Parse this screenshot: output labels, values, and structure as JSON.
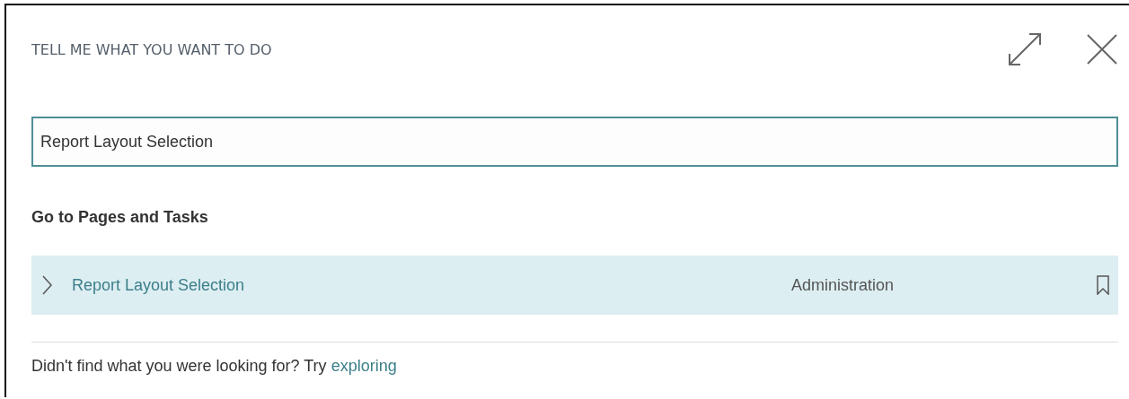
{
  "dialog": {
    "title": "TELL ME WHAT YOU WANT TO DO"
  },
  "search": {
    "value": "Report Layout Selection"
  },
  "section": {
    "title": "Go to Pages and Tasks"
  },
  "results": [
    {
      "name": "Report Layout Selection",
      "category": "Administration",
      "selected": true
    }
  ],
  "footer": {
    "text": "Didn't find what you were looking for? Try",
    "link": "exploring"
  }
}
